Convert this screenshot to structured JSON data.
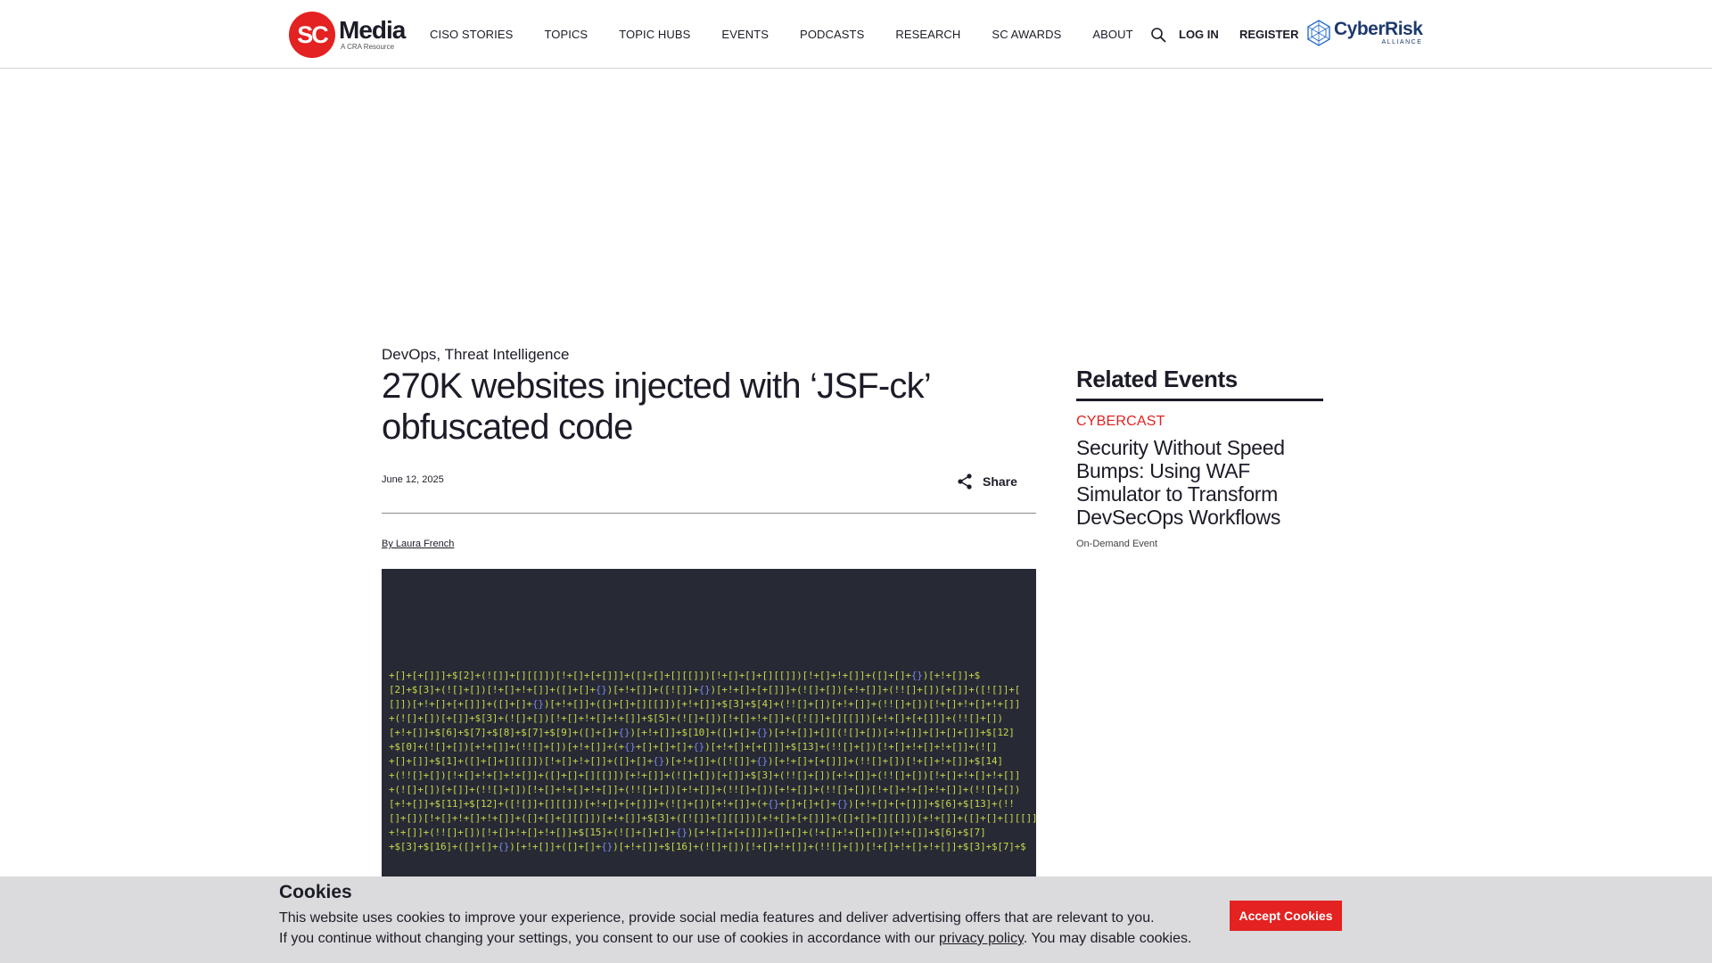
{
  "header": {
    "logo": {
      "mark": "SC",
      "name": "Media",
      "tagline": "A CRA Resource"
    },
    "nav": [
      "CISO STORIES",
      "TOPICS",
      "TOPIC HUBS",
      "EVENTS",
      "PODCASTS",
      "RESEARCH",
      "SC AWARDS",
      "ABOUT"
    ],
    "search_icon": "search-icon",
    "login_label": "LOG IN",
    "register_label": "REGISTER",
    "partner_logo": {
      "name": "CyberRisk",
      "sub": "ALLIANCE"
    }
  },
  "article": {
    "categories": [
      "DevOps",
      "Threat Intelligence"
    ],
    "category_separator": ", ",
    "title": "270K websites injected with ‘JSF-ck’ obfuscated code",
    "date": "June 12, 2025",
    "share_label": "Share",
    "author": "By Laura French"
  },
  "hero_code": [
    "+[]+[+[]]]+$[2]+(![]]+[][[]])[!+[]+[+[]]]+([]+[]+[][[]])[!+[]+[]+[][[]])[!+[]+!+[]]+([]+[]+{})[+!+[]]+$",
    "[2]+$[3]+(![]+[])[!+[]+!+[]]+([]+[]+{})[+!+[]]+([![]]+{})[+!+[]+[+[]]]+(![]+[])[+!+[]]+(!![]+[])[+[]]+([![]]+[",
    "[]])[+!+[]+[+[]]]+([]+[]+{})[+!+[]]+([]+[]+[][[]])[+!+[]]+$[3]+$[4]+(!![]+[])[+!+[]]+(!![]+[])[!+[]+!+[]+!+[]]",
    "+(![]+[])[+[]]+$[3]+(![]+[])[!+[]+!+[]+!+[]]+$[5]+(![]+[])[!+[]+!+[]]+([![]]+[][[]])[+!+[]+[+[]]]+(!![]+[])",
    "[+!+[]]+$[6]+$[7]+$[8]+$[7]+$[9]+([]+[]+{})[+!+[]]+$[10]+([]+[]+{})[+!+[]]+[][(![]+[])[+!+[]]+[]+[]+[]]+$[12]",
    "+$[0]+(![]+[])[+!+[]]+(!![]+[])[+!+[]]+(+{}+[]+[]+[]+{})[+!+[]+[+[]]]+$[13]+(!![]+[])[!+[]+!+[]+!+[]]+(![]",
    "+[]+[]]+$[1]+([]+[]+[][[]])[!+[]+!+[]]+([]+[]+{})[+!+[]]+([![]]+{})[+!+[]+[+[]]]+(!![]+[])[!+[]+!+[]]+$[14]",
    "+(!![]+[])[!+[]+!+[]+!+[]]+([]+[]+[][[]])[+!+[]]+(![]+[])[+[]]+$[3]+(!![]+[])[+!+[]]+(!![]+[])[!+[]+!+[]+!+[]]",
    "+(![]+[])[+[]]+(!![]+[])[!+[]+!+[]+!+[]]+(!![]+[])[+!+[]]+(!![]+[])[+!+[]]+(!![]+[])[!+[]+!+[]+!+[]]+(!![]+[])",
    "[+!+[]]+$[11]+$[12]+([![]]+[][[]])[+!+[]+[+[]]]+(![]+[])[+!+[]]+(+{}+[]+[]+[]+{})[+!+[]+[+[]]]+$[6]+$[13]+(!!",
    "[]+[])[!+[]+!+[]+!+[]]+([]+[]+[][[]])[+!+[]]+$[3]+([![]]+[][[]])[+!+[]+[+[]]]+([]+[]+[][[]])[+!+[]]+([]+[]+[][[]])[!+[]",
    "+!+[]]+(!![]+[])[!+[]+!+[]+!+[]]+$[15]+(![]+[]+[]+{})[+!+[]+[+[]]]+[]+[]+(!+[]+!+[]+[])[+!+[]]+$[6]+$[7]",
    "+$[3]+$[16]+([]+[]+{})[+!+[]]+([]+[]+{})[+!+[]]+$[16]+(![]+[])[!+[]+!+[]]+(!![]+[])[!+[]+!+[]+!+[]]+$[3]+$[7]+$"
  ],
  "sidebar": {
    "heading": "Related Events",
    "event": {
      "tag": "CYBERCAST",
      "title": "Security Without Speed Bumps: Using WAF Simulator to Transform DevSecOps Workflows",
      "meta": "On-Demand Event"
    }
  },
  "cookie": {
    "title": "Cookies",
    "line1": "This website uses cookies to improve your experience, provide social media features and deliver advertising offers that are relevant to you.",
    "line2_before": "If you continue without changing your settings, you consent to our use of cookies in accordance with our ",
    "line2_link": "privacy policy",
    "line2_after": ". You may disable cookies.",
    "button_label": "Accept Cookies"
  },
  "colors": {
    "brand_red": "#e32221",
    "text": "#1c1c28",
    "partner_blue": "#1e3a6e",
    "hero_bg": "#272a35",
    "code_yellow": "#c7d64a",
    "code_blue": "#7d86e6",
    "cookie_bg": "#dbdbdd"
  }
}
